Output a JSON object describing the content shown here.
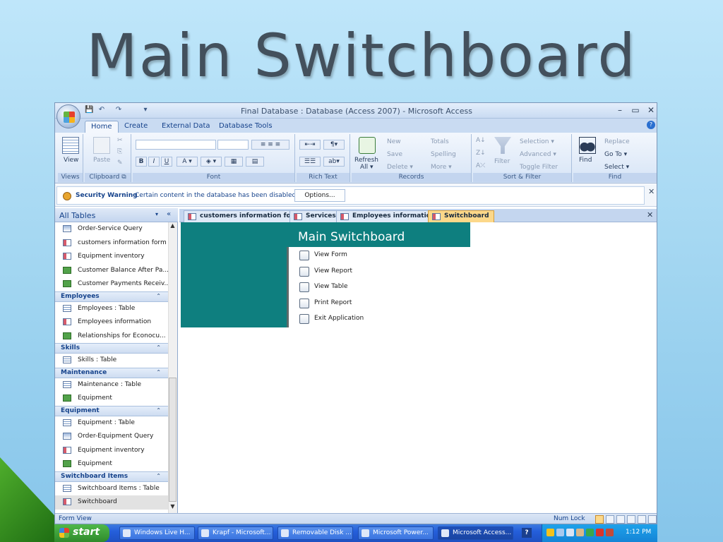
{
  "slide": {
    "title": "Main Switchboard"
  },
  "window": {
    "title": "Final Database : Database (Access 2007) - Microsoft Access",
    "controls": {
      "minimize": "–",
      "restore": "▭",
      "close": "✕"
    },
    "quick_access": {
      "save": "💾",
      "undo": "↶",
      "redo": "↷",
      "more": "▾"
    }
  },
  "ribbon": {
    "tabs": [
      "Home",
      "Create",
      "External Data",
      "Database Tools"
    ],
    "help": "?",
    "groups": {
      "views": {
        "label": "Views",
        "view": "View"
      },
      "clipboard": {
        "label": "Clipboard",
        "paste": "Paste",
        "launcher": "⧉"
      },
      "font": {
        "label": "Font",
        "bold": "B",
        "italic": "I",
        "underline": "U",
        "launcher": "⧉"
      },
      "rich_text": {
        "label": "Rich Text"
      },
      "records": {
        "label": "Records",
        "refresh": "Refresh",
        "refresh_all": "All ▾",
        "new": "New",
        "save": "Save",
        "delete": "Delete ▾",
        "totals": "Totals",
        "spelling": "Spelling",
        "more": "More ▾"
      },
      "sort_filter": {
        "label": "Sort & Filter",
        "filter": "Filter",
        "selection": "Selection ▾",
        "advanced": "Advanced ▾",
        "toggle": "Toggle Filter"
      },
      "find": {
        "label": "Find",
        "find": "Find",
        "replace": "Replace",
        "goto": "Go To ▾",
        "select": "Select ▾"
      }
    }
  },
  "security": {
    "title": "Security Warning",
    "message": "Certain content in the database has been disabled",
    "options": "Options...",
    "close": "✕"
  },
  "nav": {
    "title": "All Tables",
    "dropdown": "▾",
    "collapse": "«",
    "scroll_up": "▲",
    "scroll_down": "▼",
    "top_items": [
      {
        "label": "Order-Service Query",
        "kind": "qry"
      },
      {
        "label": "customers information form",
        "kind": "frm"
      },
      {
        "label": "Equipment inventory",
        "kind": "frm"
      },
      {
        "label": "Customer Balance After Pa...",
        "kind": "rpt"
      },
      {
        "label": "Customer Payments Receiv...",
        "kind": "rpt"
      }
    ],
    "groups": [
      {
        "name": "Employees",
        "chev": "⌃",
        "items": [
          {
            "label": "Employees : Table",
            "kind": "tbl"
          },
          {
            "label": "Employees information",
            "kind": "frm"
          },
          {
            "label": "Relationships for Econocu...",
            "kind": "rpt"
          }
        ]
      },
      {
        "name": "Skills",
        "chev": "⌃",
        "items": [
          {
            "label": "Skills : Table",
            "kind": "tbl"
          }
        ]
      },
      {
        "name": "Maintenance",
        "chev": "⌃",
        "items": [
          {
            "label": "Maintenance : Table",
            "kind": "tbl"
          },
          {
            "label": "Equipment",
            "kind": "rpt"
          }
        ]
      },
      {
        "name": "Equipment",
        "chev": "⌃",
        "items": [
          {
            "label": "Equipment : Table",
            "kind": "tbl"
          },
          {
            "label": "Order-Equipment Query",
            "kind": "qry"
          },
          {
            "label": "Equipment inventory",
            "kind": "frm"
          },
          {
            "label": "Equipment",
            "kind": "rpt"
          }
        ]
      },
      {
        "name": "Switchboard Items",
        "chev": "⌃",
        "items": [
          {
            "label": "Switchboard Items : Table",
            "kind": "tbl"
          },
          {
            "label": "Switchboard",
            "kind": "frm",
            "selected": true
          }
        ]
      }
    ]
  },
  "doc_tabs": [
    {
      "label": "customers information form"
    },
    {
      "label": "Services"
    },
    {
      "label": "Employees information"
    },
    {
      "label": "Switchboard",
      "active": true
    }
  ],
  "doc_close": "✕",
  "form": {
    "title": "Main Switchboard",
    "buttons": [
      "View Form",
      "View Report",
      "View Table",
      "Print Report",
      "Exit Application"
    ]
  },
  "status": {
    "left": "Form View",
    "numlock": "Num Lock"
  },
  "taskbar": {
    "start": "start",
    "tasks": [
      {
        "label": "Windows Live H..."
      },
      {
        "label": "Krapf - Microsoft..."
      },
      {
        "label": "Removable Disk ..."
      },
      {
        "label": "Microsoft Power..."
      },
      {
        "label": "Microsoft Access...",
        "active": true
      }
    ],
    "help": "?",
    "clock": "1:12 PM"
  },
  "colors": {
    "form_teal": "#0e7f7f",
    "active_tab": "#fcd88a",
    "ribbon_text": "#15428b"
  }
}
